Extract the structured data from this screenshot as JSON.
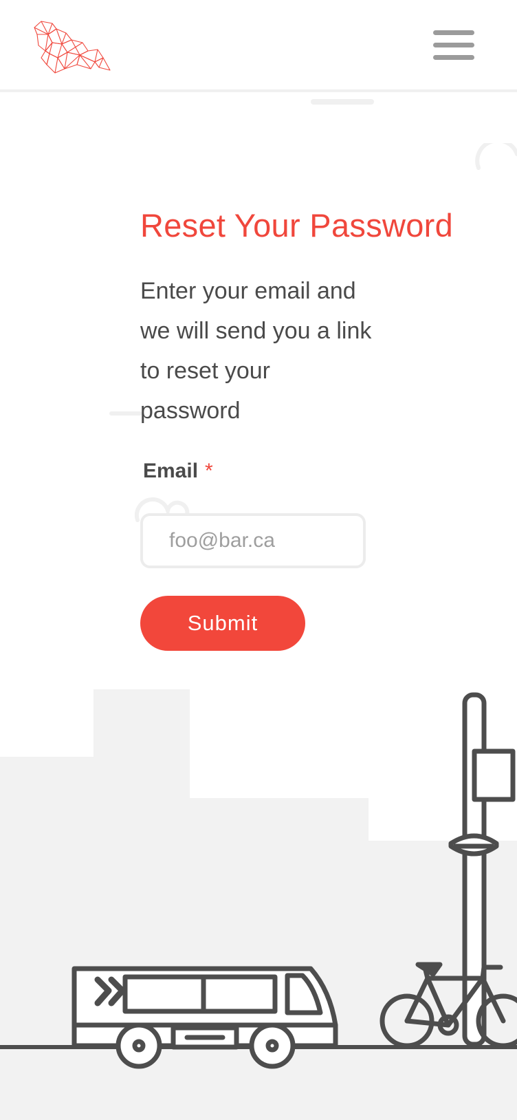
{
  "header": {
    "logo": "geometric-polygon-seal-logo",
    "menu_icon": "hamburger-menu-icon"
  },
  "form": {
    "title": "Reset Your Password",
    "description": "Enter your email and we will send you a link to reset your password",
    "email_label": "Email",
    "required_marker": "*",
    "email_placeholder": "foo@bar.ca",
    "email_value": "",
    "submit_label": "Submit"
  },
  "illustration": {
    "items": [
      "city-skyline",
      "bus-icon",
      "bicycle-icon",
      "lamp-post-icon"
    ]
  },
  "colors": {
    "accent": "#f0473c",
    "text": "#4a4a4a",
    "placeholder": "#9e9e9e",
    "border": "#ececec",
    "illustration_stroke": "#4d4d4d",
    "skyline_fill": "#f2f2f2"
  }
}
